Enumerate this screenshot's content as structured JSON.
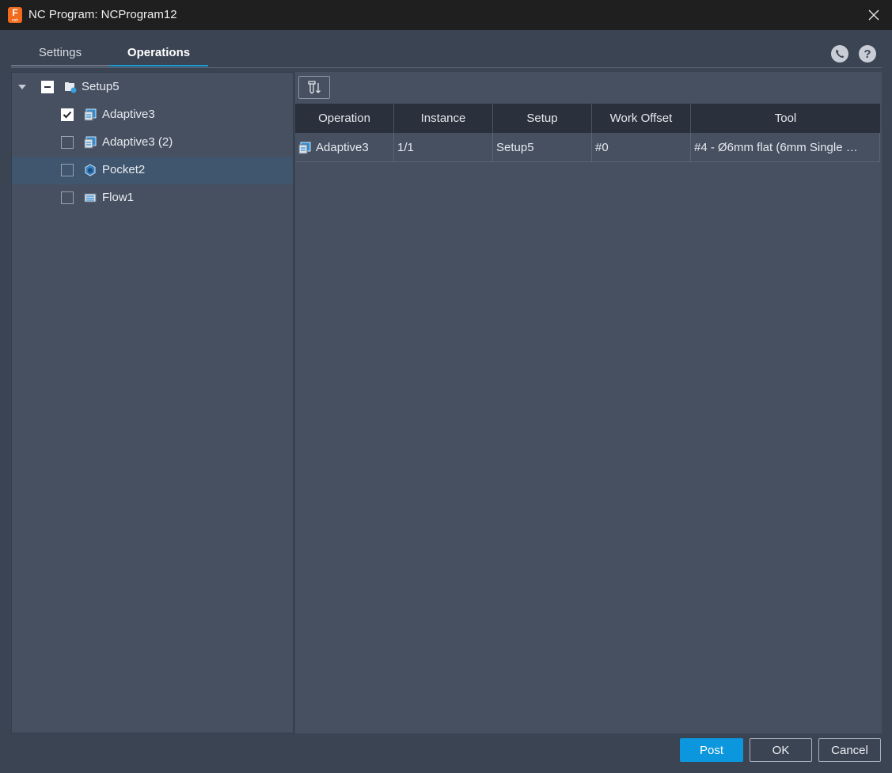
{
  "window": {
    "title": "NC Program: NCProgram12",
    "app_icon_letter": "F",
    "app_icon_sub": "nsh"
  },
  "tabs": [
    {
      "label": "Settings",
      "active": false
    },
    {
      "label": "Operations",
      "active": true
    }
  ],
  "header_icons": {
    "phone": "phone-icon",
    "help": "?"
  },
  "tree": {
    "setup": {
      "label": "Setup5",
      "expanded": true,
      "check": "partial"
    },
    "items": [
      {
        "label": "Adaptive3",
        "checked": true,
        "icon": "adaptive-icon",
        "selected": false
      },
      {
        "label": "Adaptive3 (2)",
        "checked": false,
        "icon": "adaptive-icon",
        "selected": false
      },
      {
        "label": "Pocket2",
        "checked": false,
        "icon": "pocket-icon",
        "selected": true
      },
      {
        "label": "Flow1",
        "checked": false,
        "icon": "flow-icon",
        "selected": false
      }
    ]
  },
  "table": {
    "columns": [
      "Operation",
      "Instance",
      "Setup",
      "Work Offset",
      "Tool"
    ],
    "rows": [
      {
        "operation": "Adaptive3",
        "instance": "1/1",
        "setup": "Setup5",
        "work_offset": "#0",
        "tool": "#4 - Ø6mm flat (6mm Single …"
      }
    ]
  },
  "footer": {
    "post": "Post",
    "ok": "OK",
    "cancel": "Cancel"
  },
  "colors": {
    "accent": "#0b96de",
    "panel": "#465061",
    "background": "#3b4453",
    "selected_row": "#3f566e"
  }
}
